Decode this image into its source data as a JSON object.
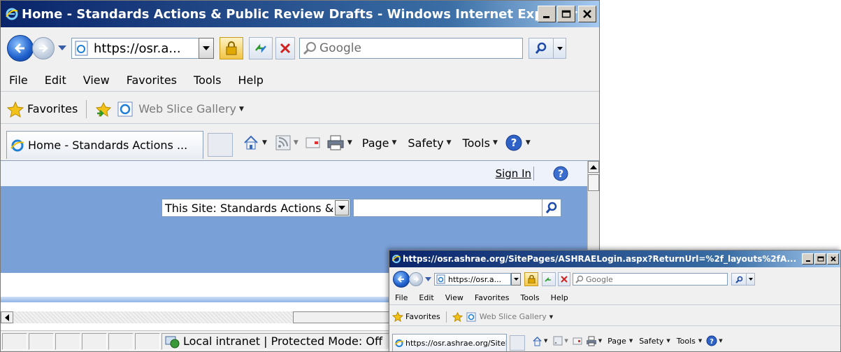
{
  "window1": {
    "title": "Home - Standards Actions & Public Review Drafts - Windows Internet Explorer",
    "address": "https://osr.a...",
    "search_placeholder": "Google",
    "menu": [
      "File",
      "Edit",
      "View",
      "Favorites",
      "Tools",
      "Help"
    ],
    "favorites_label": "Favorites",
    "web_slice_label": "Web Slice Gallery",
    "tab_label": "Home - Standards Actions ...",
    "commands": {
      "page": "Page",
      "safety": "Safety",
      "tools": "Tools"
    },
    "page": {
      "sign_in": "Sign In",
      "scope_selected": "This Site: Standards Actions &",
      "search_value": ""
    },
    "status": {
      "zone": "Local intranet | Protected Mode: Off"
    }
  },
  "window2": {
    "title": "https://osr.ashrae.org/SitePages/ASHRAELogin.aspx?ReturnUrl=%2f_layouts%2fA...",
    "address": "https://osr.a...",
    "search_placeholder": "Google",
    "menu": [
      "File",
      "Edit",
      "View",
      "Favorites",
      "Tools",
      "Help"
    ],
    "favorites_label": "Favorites",
    "web_slice_label": "Web Slice Gallery",
    "tab_label": "https://osr.ashrae.org/SitePages/...",
    "commands": {
      "page": "Page",
      "safety": "Safety",
      "tools": "Tools"
    }
  },
  "colors": {
    "page_header_band": "#7aa0d8",
    "page_top_strip": "#eef3fb",
    "title_gradient_start": "#0a246a"
  }
}
